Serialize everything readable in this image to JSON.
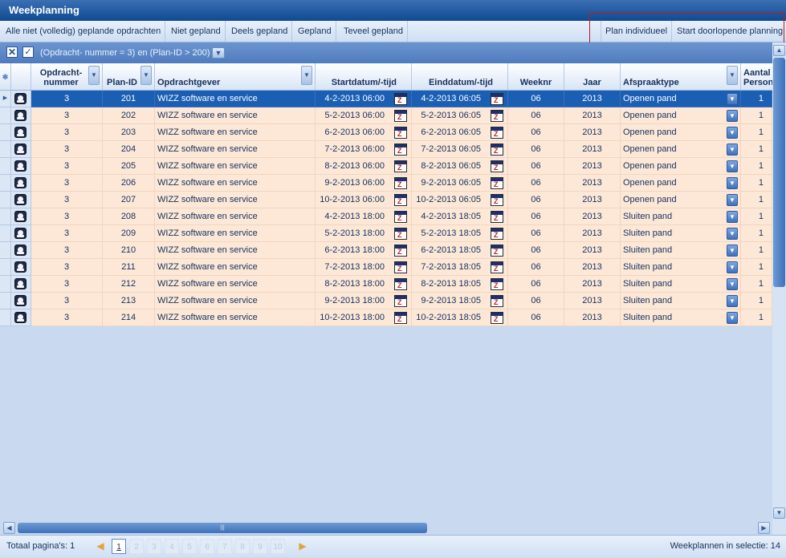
{
  "window": {
    "title": "Weekplanning"
  },
  "toolbar": {
    "left": [
      "Alle niet (volledig) geplande opdrachten",
      "Niet gepland",
      "Deels gepland",
      "Gepland",
      "Teveel gepland"
    ],
    "right": [
      "Plan individueel",
      "Start doorlopende planning"
    ]
  },
  "filter": {
    "text": "(Opdracht- nummer = 3) en (Plan-ID > 200)"
  },
  "columns": {
    "opdrachtnummer": "Opdracht-\nnummer",
    "plan_id": "Plan-ID",
    "opdrachtgever": "Opdrachtgever",
    "start": "Startdatum/-tijd",
    "eind": "Einddatum/-tijd",
    "weeknr": "Weeknr",
    "jaar": "Jaar",
    "afspraaktype": "Afspraaktype",
    "aantal": "Aantal\nPersonen"
  },
  "rows": [
    {
      "opdrachtnummer": "3",
      "plan_id": "201",
      "opdrachtgever": "WIZZ software en service",
      "start": "4-2-2013 06:00",
      "eind": "4-2-2013 06:05",
      "weeknr": "06",
      "jaar": "2013",
      "afspraaktype": "Openen pand",
      "aantal": "1"
    },
    {
      "opdrachtnummer": "3",
      "plan_id": "202",
      "opdrachtgever": "WIZZ software en service",
      "start": "5-2-2013 06:00",
      "eind": "5-2-2013 06:05",
      "weeknr": "06",
      "jaar": "2013",
      "afspraaktype": "Openen pand",
      "aantal": "1"
    },
    {
      "opdrachtnummer": "3",
      "plan_id": "203",
      "opdrachtgever": "WIZZ software en service",
      "start": "6-2-2013 06:00",
      "eind": "6-2-2013 06:05",
      "weeknr": "06",
      "jaar": "2013",
      "afspraaktype": "Openen pand",
      "aantal": "1"
    },
    {
      "opdrachtnummer": "3",
      "plan_id": "204",
      "opdrachtgever": "WIZZ software en service",
      "start": "7-2-2013 06:00",
      "eind": "7-2-2013 06:05",
      "weeknr": "06",
      "jaar": "2013",
      "afspraaktype": "Openen pand",
      "aantal": "1"
    },
    {
      "opdrachtnummer": "3",
      "plan_id": "205",
      "opdrachtgever": "WIZZ software en service",
      "start": "8-2-2013 06:00",
      "eind": "8-2-2013 06:05",
      "weeknr": "06",
      "jaar": "2013",
      "afspraaktype": "Openen pand",
      "aantal": "1"
    },
    {
      "opdrachtnummer": "3",
      "plan_id": "206",
      "opdrachtgever": "WIZZ software en service",
      "start": "9-2-2013 06:00",
      "eind": "9-2-2013 06:05",
      "weeknr": "06",
      "jaar": "2013",
      "afspraaktype": "Openen pand",
      "aantal": "1"
    },
    {
      "opdrachtnummer": "3",
      "plan_id": "207",
      "opdrachtgever": "WIZZ software en service",
      "start": "10-2-2013 06:00",
      "eind": "10-2-2013 06:05",
      "weeknr": "06",
      "jaar": "2013",
      "afspraaktype": "Openen pand",
      "aantal": "1"
    },
    {
      "opdrachtnummer": "3",
      "plan_id": "208",
      "opdrachtgever": "WIZZ software en service",
      "start": "4-2-2013 18:00",
      "eind": "4-2-2013 18:05",
      "weeknr": "06",
      "jaar": "2013",
      "afspraaktype": "Sluiten pand",
      "aantal": "1"
    },
    {
      "opdrachtnummer": "3",
      "plan_id": "209",
      "opdrachtgever": "WIZZ software en service",
      "start": "5-2-2013 18:00",
      "eind": "5-2-2013 18:05",
      "weeknr": "06",
      "jaar": "2013",
      "afspraaktype": "Sluiten pand",
      "aantal": "1"
    },
    {
      "opdrachtnummer": "3",
      "plan_id": "210",
      "opdrachtgever": "WIZZ software en service",
      "start": "6-2-2013 18:00",
      "eind": "6-2-2013 18:05",
      "weeknr": "06",
      "jaar": "2013",
      "afspraaktype": "Sluiten pand",
      "aantal": "1"
    },
    {
      "opdrachtnummer": "3",
      "plan_id": "211",
      "opdrachtgever": "WIZZ software en service",
      "start": "7-2-2013 18:00",
      "eind": "7-2-2013 18:05",
      "weeknr": "06",
      "jaar": "2013",
      "afspraaktype": "Sluiten pand",
      "aantal": "1"
    },
    {
      "opdrachtnummer": "3",
      "plan_id": "212",
      "opdrachtgever": "WIZZ software en service",
      "start": "8-2-2013 18:00",
      "eind": "8-2-2013 18:05",
      "weeknr": "06",
      "jaar": "2013",
      "afspraaktype": "Sluiten pand",
      "aantal": "1"
    },
    {
      "opdrachtnummer": "3",
      "plan_id": "213",
      "opdrachtgever": "WIZZ software en service",
      "start": "9-2-2013 18:00",
      "eind": "9-2-2013 18:05",
      "weeknr": "06",
      "jaar": "2013",
      "afspraaktype": "Sluiten pand",
      "aantal": "1"
    },
    {
      "opdrachtnummer": "3",
      "plan_id": "214",
      "opdrachtgever": "WIZZ software en service",
      "start": "10-2-2013 18:00",
      "eind": "10-2-2013 18:05",
      "weeknr": "06",
      "jaar": "2013",
      "afspraaktype": "Sluiten pand",
      "aantal": "1"
    }
  ],
  "selected_row": 0,
  "pager": {
    "total_label": "Totaal pagina's: 1",
    "pages": [
      "1",
      "2",
      "3",
      "4",
      "5",
      "6",
      "7",
      "8",
      "9",
      "10"
    ],
    "current_page": "1",
    "selection_label": "Weekplannen in selectie: 14"
  },
  "colors": {
    "row_bg": "#fde8d8",
    "selected_bg": "#1a5fb4",
    "title_bg": "#0f4a92",
    "highlight_box": "#c4161c"
  }
}
